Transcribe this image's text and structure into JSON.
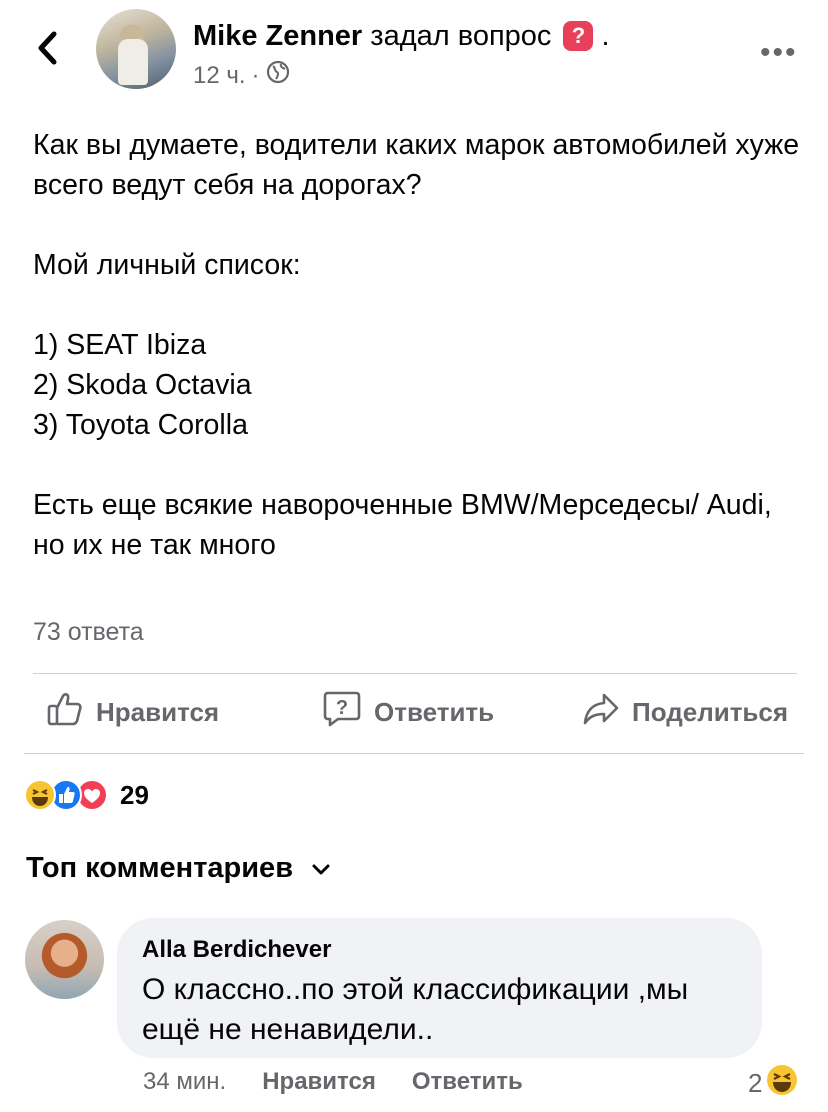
{
  "header": {
    "author_name": "Mike Zenner",
    "action_text": "задал вопрос",
    "question_badge": "?",
    "trailing": ".",
    "time": "12 ч.",
    "separator": "·",
    "privacy_icon": "globe-icon",
    "more_icon": "more-icon",
    "more_label": "•••",
    "back_icon": "back-chevron-icon"
  },
  "post": {
    "paragraphs": [
      "Как вы думаете, водители каких марок автомобилей хуже всего ведут себя на дорогах?",
      "",
      "Мой личный список:",
      "",
      "1) SEAT Ibiza",
      "2) Skoda Octavia",
      "3) Toyota Corolla",
      "",
      "Есть еще всякие навороченные BMW/Мерседесы/ Audi, но их не так много"
    ]
  },
  "answers_count": "73 ответа",
  "actions": {
    "like_label": "Нравится",
    "answer_label": "Ответить",
    "share_label": "Поделиться"
  },
  "reactions": {
    "types": [
      "haha",
      "like",
      "love"
    ],
    "count": "29"
  },
  "comments_section": {
    "sort_label": "Топ комментариев"
  },
  "comment": {
    "author": "Alla Berdichever",
    "text": "О классно..по этой классификации ,мы ещё не ненавидели..",
    "time": "34 мин.",
    "like_label": "Нравится",
    "reply_label": "Ответить",
    "reaction_count": "2",
    "reaction_type": "haha"
  },
  "colors": {
    "text": "#050505",
    "secondary": "#65676b",
    "divider": "#ced0d4",
    "bubble": "#f0f2f5",
    "like": "#1877f2",
    "love": "#f33e58",
    "haha": "#f7c531",
    "question_badge": "#e8405b"
  }
}
